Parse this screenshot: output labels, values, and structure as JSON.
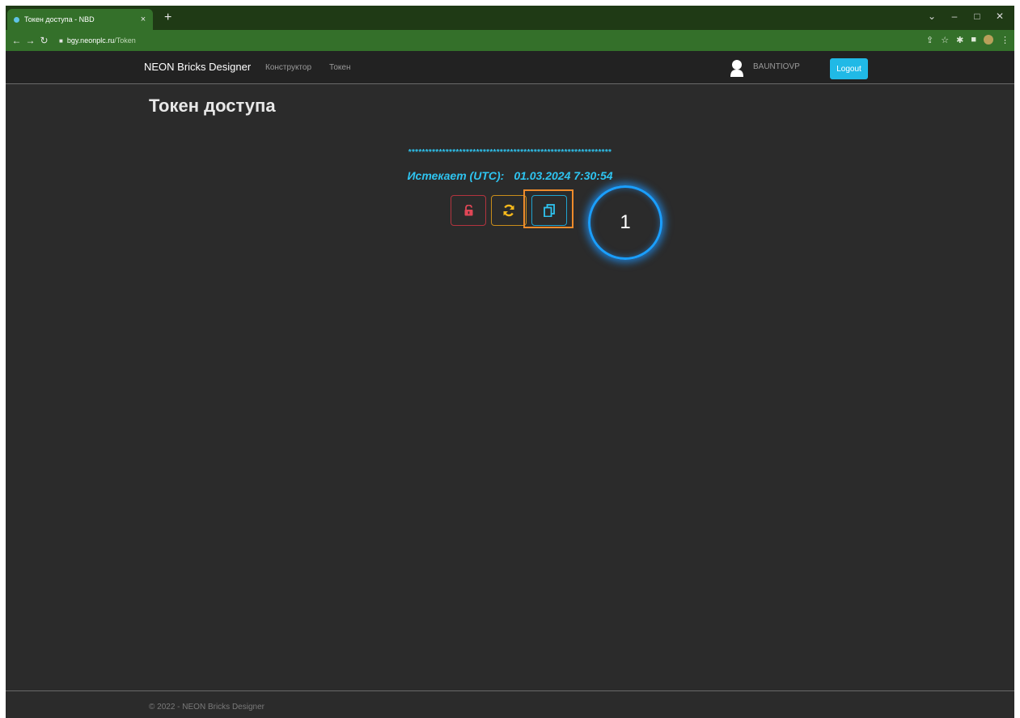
{
  "browser": {
    "tab_title": "Токен доступа - NBD",
    "tab_close": "×",
    "new_tab": "+",
    "url_host": "bgy.neonplc.ru",
    "url_path": "/Token",
    "window_controls": [
      "⌄",
      "–",
      "□",
      "✕"
    ]
  },
  "navbar": {
    "brand": "NEON Bricks Designer",
    "links": [
      "Конструктор",
      "Токен"
    ],
    "username": "BAUNTIOVP",
    "logout_label": "Logout"
  },
  "main": {
    "title": "Токен доступа",
    "token_masked": "************************************************************",
    "expires_label": "Истекает (UTC):",
    "expires_value": "01.03.2024 7:30:54",
    "buttons": [
      {
        "icon": "unlock-icon",
        "color": "#e04656"
      },
      {
        "icon": "refresh-icon",
        "color": "#f5b81c"
      },
      {
        "icon": "copy-icon",
        "color": "#2ec4f0"
      }
    ]
  },
  "annotation": {
    "callout_number": "1",
    "highlight_color": "#ee8b2b",
    "callout_color": "#1a9fff"
  },
  "footer": {
    "text": "© 2022 - NEON Bricks Designer"
  }
}
